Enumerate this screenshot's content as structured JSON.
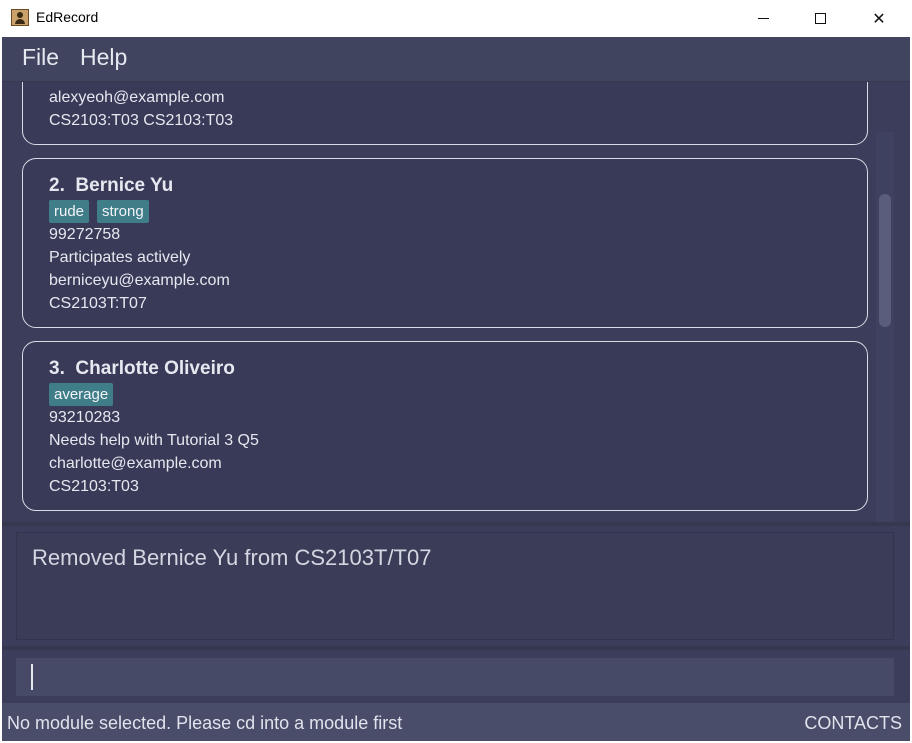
{
  "window": {
    "title": "EdRecord"
  },
  "menu": {
    "file": "File",
    "help": "Help"
  },
  "cards": [
    {
      "email": "alexyeoh@example.com",
      "modules": "CS2103:T03 CS2103:T03"
    },
    {
      "index": "2.",
      "name": "Bernice Yu",
      "tags": [
        "rude",
        "strong"
      ],
      "phone": "99272758",
      "info": "Participates actively",
      "email": "berniceyu@example.com",
      "modules": "CS2103T:T07"
    },
    {
      "index": "3.",
      "name": "Charlotte Oliveiro",
      "tags": [
        "average"
      ],
      "phone": "93210283",
      "info": "Needs help with Tutorial 3 Q5",
      "email": "charlotte@example.com",
      "modules": "CS2103:T03"
    }
  ],
  "result": {
    "message": "Removed Bernice Yu from CS2103T/T07"
  },
  "command": {
    "value": ""
  },
  "status": {
    "left": "No module selected. Please cd into a module first",
    "right": "CONTACTS"
  },
  "colors": {
    "background": "#3b3d5a",
    "tag": "#3f7d88",
    "card_border": "#d9dbe6"
  }
}
